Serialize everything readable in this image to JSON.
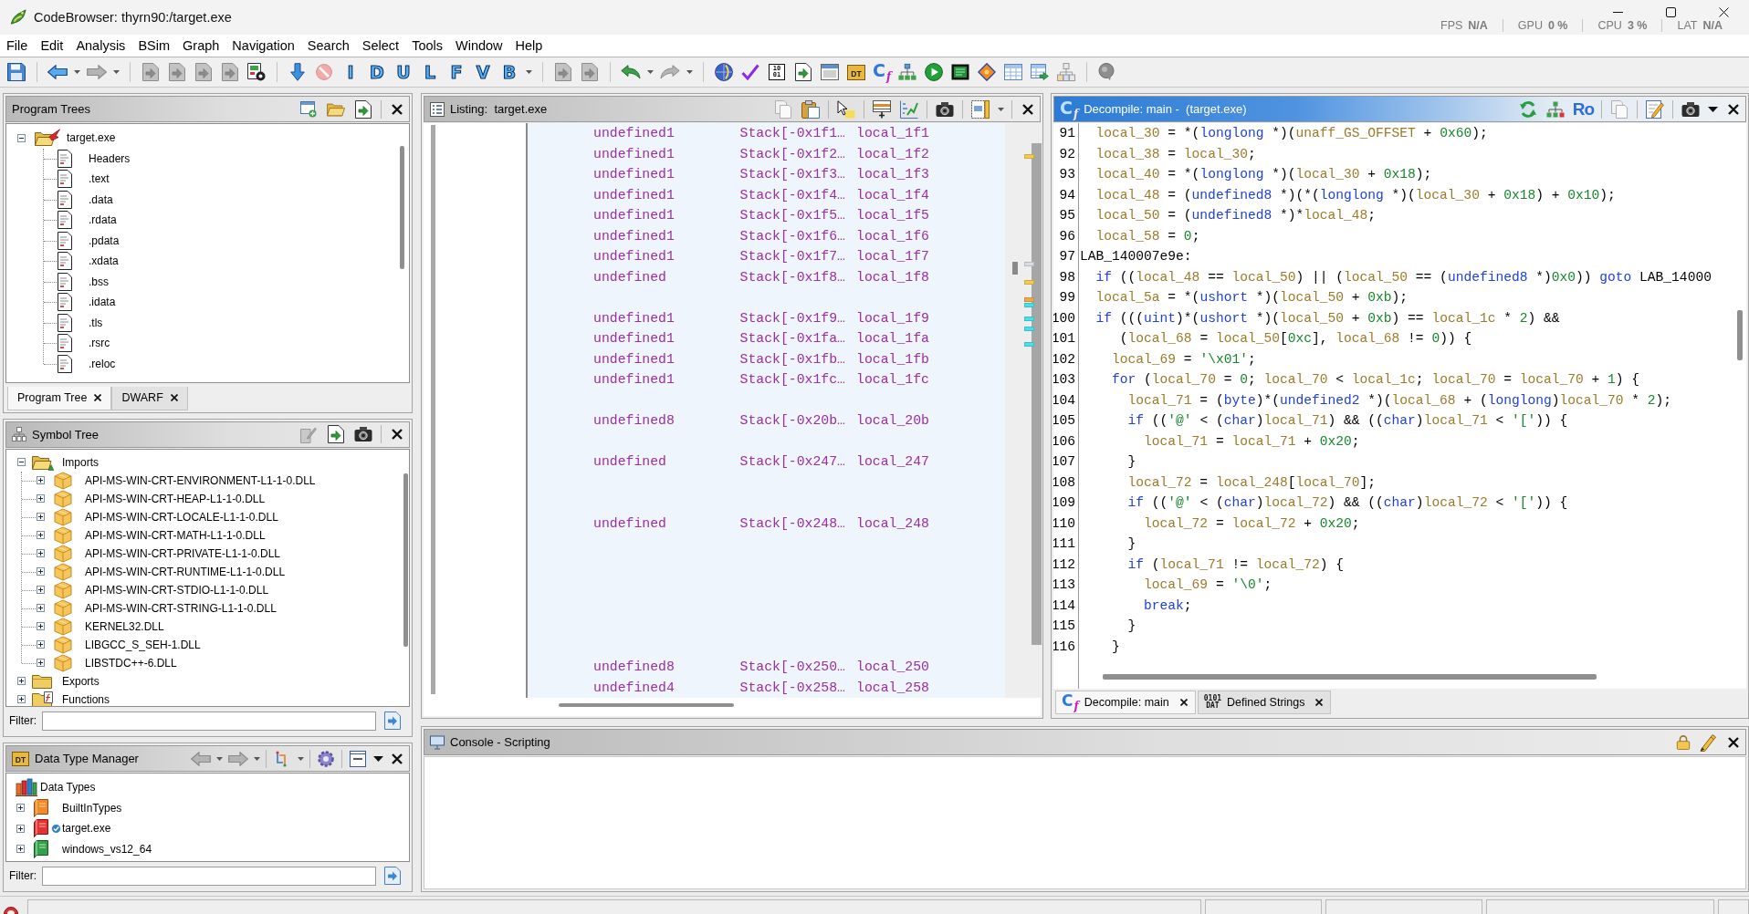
{
  "window": {
    "title": "CodeBrowser: thyrn90:/target.exe"
  },
  "perf_overlay": [
    {
      "label": "FPS",
      "value": "N/A"
    },
    {
      "label": "GPU",
      "value": "0 %"
    },
    {
      "label": "CPU",
      "value": "3 %"
    },
    {
      "label": "LAT",
      "value": "N/A"
    }
  ],
  "menu": [
    "File",
    "Edit",
    "Analysis",
    "BSim",
    "Graph",
    "Navigation",
    "Search",
    "Select",
    "Tools",
    "Window",
    "Help"
  ],
  "toolbar": {
    "letter_tools": [
      "I",
      "D",
      "U",
      "L",
      "F",
      "V",
      "B"
    ],
    "bytes_tool": [
      "10",
      "01"
    ],
    "data_type_tool": "DT",
    "decompiler_tool": [
      "C",
      "f"
    ]
  },
  "program_trees": {
    "title": "Program Trees",
    "active": false,
    "root": {
      "label": "target.exe",
      "expanded": true,
      "children": [
        {
          "label": "Headers"
        },
        {
          "label": ".text"
        },
        {
          "label": ".data"
        },
        {
          "label": ".rdata"
        },
        {
          "label": ".pdata"
        },
        {
          "label": ".xdata"
        },
        {
          "label": ".bss"
        },
        {
          "label": ".idata"
        },
        {
          "label": ".tls"
        },
        {
          "label": ".rsrc"
        },
        {
          "label": ".reloc"
        }
      ]
    },
    "tabs": [
      {
        "label": "Program Tree",
        "selected": true
      },
      {
        "label": "DWARF",
        "selected": false
      }
    ]
  },
  "symbol_tree": {
    "title": "Symbol Tree",
    "active": false,
    "items": [
      {
        "kind": "imports",
        "label": "Imports",
        "expanded": true,
        "children": [
          {
            "label": "API-MS-WIN-CRT-ENVIRONMENT-L1-1-0.DLL",
            "expanded": false
          },
          {
            "label": "API-MS-WIN-CRT-HEAP-L1-1-0.DLL",
            "expanded": false
          },
          {
            "label": "API-MS-WIN-CRT-LOCALE-L1-1-0.DLL",
            "expanded": false
          },
          {
            "label": "API-MS-WIN-CRT-MATH-L1-1-0.DLL",
            "expanded": false
          },
          {
            "label": "API-MS-WIN-CRT-PRIVATE-L1-1-0.DLL",
            "expanded": false
          },
          {
            "label": "API-MS-WIN-CRT-RUNTIME-L1-1-0.DLL",
            "expanded": false
          },
          {
            "label": "API-MS-WIN-CRT-STDIO-L1-1-0.DLL",
            "expanded": false
          },
          {
            "label": "API-MS-WIN-CRT-STRING-L1-1-0.DLL",
            "expanded": false
          },
          {
            "label": "KERNEL32.DLL",
            "expanded": false
          },
          {
            "label": "LIBGCC_S_SEH-1.DLL",
            "expanded": false
          },
          {
            "label": "LIBSTDC++-6.DLL",
            "expanded": false
          }
        ]
      },
      {
        "kind": "exports",
        "label": "Exports",
        "expanded": false
      },
      {
        "kind": "functions",
        "label": "Functions",
        "expanded": false
      }
    ],
    "filter_label": "Filter:"
  },
  "data_type_manager": {
    "title": "Data Type Manager",
    "active": false,
    "icon_text": "DT",
    "root": {
      "label": "Data Types",
      "children": [
        {
          "kind": "builtin",
          "label": "BuiltInTypes",
          "expanded": false
        },
        {
          "kind": "program",
          "label": "target.exe",
          "expanded": false
        },
        {
          "kind": "archive",
          "label": "windows_vs12_64",
          "expanded": false
        }
      ]
    },
    "filter_label": "Filter:"
  },
  "listing": {
    "title": "Listing:  target.exe",
    "active": false,
    "rows": [
      {
        "kind": "variable",
        "type": "undefined1",
        "location": "Stack[-0x1f1…",
        "name": "local_1f1"
      },
      {
        "kind": "variable",
        "type": "undefined1",
        "location": "Stack[-0x1f2…",
        "name": "local_1f2"
      },
      {
        "kind": "variable",
        "type": "undefined1",
        "location": "Stack[-0x1f3…",
        "name": "local_1f3"
      },
      {
        "kind": "variable",
        "type": "undefined1",
        "location": "Stack[-0x1f4…",
        "name": "local_1f4"
      },
      {
        "kind": "variable",
        "type": "undefined1",
        "location": "Stack[-0x1f5…",
        "name": "local_1f5"
      },
      {
        "kind": "variable",
        "type": "undefined1",
        "location": "Stack[-0x1f6…",
        "name": "local_1f6"
      },
      {
        "kind": "variable",
        "type": "undefined1",
        "location": "Stack[-0x1f7…",
        "name": "local_1f7"
      },
      {
        "kind": "variable",
        "type": "undefined",
        "location": "Stack[-0x1f8…",
        "name": "local_1f8"
      },
      {
        "kind": "blank"
      },
      {
        "kind": "variable",
        "type": "undefined1",
        "location": "Stack[-0x1f9…",
        "name": "local_1f9"
      },
      {
        "kind": "variable",
        "type": "undefined1",
        "location": "Stack[-0x1fa…",
        "name": "local_1fa"
      },
      {
        "kind": "variable",
        "type": "undefined1",
        "location": "Stack[-0x1fb…",
        "name": "local_1fb"
      },
      {
        "kind": "variable",
        "type": "undefined1",
        "location": "Stack[-0x1fc…",
        "name": "local_1fc"
      },
      {
        "kind": "blank"
      },
      {
        "kind": "variable",
        "type": "undefined8",
        "location": "Stack[-0x20b…",
        "name": "local_20b"
      },
      {
        "kind": "blank"
      },
      {
        "kind": "variable",
        "type": "undefined",
        "location": "Stack[-0x247…",
        "name": "local_247"
      },
      {
        "kind": "blank"
      },
      {
        "kind": "blank"
      },
      {
        "kind": "variable",
        "type": "undefined",
        "location": "Stack[-0x248…",
        "name": "local_248"
      },
      {
        "kind": "blank"
      },
      {
        "kind": "blank"
      },
      {
        "kind": "blank"
      },
      {
        "kind": "blank"
      },
      {
        "kind": "blank"
      },
      {
        "kind": "blank"
      },
      {
        "kind": "variable",
        "type": "undefined8",
        "location": "Stack[-0x250…",
        "name": "local_250"
      },
      {
        "kind": "variable",
        "type": "undefined4",
        "location": "Stack[-0x258…",
        "name": "local_258"
      }
    ]
  },
  "decompile": {
    "title": "Decompile: main -  (target.exe)",
    "active": true,
    "icon_text": [
      "C",
      "f"
    ],
    "toolbar_text": "Ro",
    "lines": [
      {
        "number": "91",
        "tokens": [
          {
            "kind": "var",
            "text": "  local_30"
          },
          {
            "kind": "plain",
            "text": " = *("
          },
          {
            "kind": "type",
            "text": "longlong"
          },
          {
            "kind": "plain",
            "text": " *)("
          },
          {
            "kind": "var",
            "text": "unaff_GS_OFFSET"
          },
          {
            "kind": "plain",
            "text": " + "
          },
          {
            "kind": "const",
            "text": "0x60"
          },
          {
            "kind": "plain",
            "text": ");"
          }
        ]
      },
      {
        "number": "92",
        "tokens": [
          {
            "kind": "var",
            "text": "  local_38"
          },
          {
            "kind": "plain",
            "text": " = "
          },
          {
            "kind": "var",
            "text": "local_30"
          },
          {
            "kind": "plain",
            "text": ";"
          }
        ]
      },
      {
        "number": "93",
        "tokens": [
          {
            "kind": "var",
            "text": "  local_40"
          },
          {
            "kind": "plain",
            "text": " = *("
          },
          {
            "kind": "type",
            "text": "longlong"
          },
          {
            "kind": "plain",
            "text": " *)("
          },
          {
            "kind": "var",
            "text": "local_30"
          },
          {
            "kind": "plain",
            "text": " + "
          },
          {
            "kind": "const",
            "text": "0x18"
          },
          {
            "kind": "plain",
            "text": ");"
          }
        ]
      },
      {
        "number": "94",
        "tokens": [
          {
            "kind": "var",
            "text": "  local_48"
          },
          {
            "kind": "plain",
            "text": " = ("
          },
          {
            "kind": "type",
            "text": "undefined8"
          },
          {
            "kind": "plain",
            "text": " *)(*("
          },
          {
            "kind": "type",
            "text": "longlong"
          },
          {
            "kind": "plain",
            "text": " *)("
          },
          {
            "kind": "var",
            "text": "local_30"
          },
          {
            "kind": "plain",
            "text": " + "
          },
          {
            "kind": "const",
            "text": "0x18"
          },
          {
            "kind": "plain",
            "text": ") + "
          },
          {
            "kind": "const",
            "text": "0x10"
          },
          {
            "kind": "plain",
            "text": ");"
          }
        ]
      },
      {
        "number": "95",
        "tokens": [
          {
            "kind": "var",
            "text": "  local_50"
          },
          {
            "kind": "plain",
            "text": " = ("
          },
          {
            "kind": "type",
            "text": "undefined8"
          },
          {
            "kind": "plain",
            "text": " *)*"
          },
          {
            "kind": "var",
            "text": "local_48"
          },
          {
            "kind": "plain",
            "text": ";"
          }
        ]
      },
      {
        "number": "96",
        "tokens": [
          {
            "kind": "var",
            "text": "  local_58"
          },
          {
            "kind": "plain",
            "text": " = "
          },
          {
            "kind": "const",
            "text": "0"
          },
          {
            "kind": "plain",
            "text": ";"
          }
        ]
      },
      {
        "number": "97",
        "tokens": [
          {
            "kind": "label",
            "text": "LAB_140007e9e:"
          }
        ]
      },
      {
        "number": "98",
        "tokens": [
          {
            "kind": "keyword",
            "text": "  if"
          },
          {
            "kind": "plain",
            "text": " (("
          },
          {
            "kind": "var",
            "text": "local_48"
          },
          {
            "kind": "plain",
            "text": " == "
          },
          {
            "kind": "var",
            "text": "local_50"
          },
          {
            "kind": "plain",
            "text": ") || ("
          },
          {
            "kind": "var",
            "text": "local_50"
          },
          {
            "kind": "plain",
            "text": " == ("
          },
          {
            "kind": "type",
            "text": "undefined8"
          },
          {
            "kind": "plain",
            "text": " *)"
          },
          {
            "kind": "const",
            "text": "0x0"
          },
          {
            "kind": "plain",
            "text": ")) "
          },
          {
            "kind": "keyword",
            "text": "goto"
          },
          {
            "kind": "label",
            "text": " LAB_14000"
          }
        ]
      },
      {
        "number": "99",
        "tokens": [
          {
            "kind": "var",
            "text": "  local_5a"
          },
          {
            "kind": "plain",
            "text": " = *("
          },
          {
            "kind": "type",
            "text": "ushort"
          },
          {
            "kind": "plain",
            "text": " *)("
          },
          {
            "kind": "var",
            "text": "local_50"
          },
          {
            "kind": "plain",
            "text": " + "
          },
          {
            "kind": "const",
            "text": "0xb"
          },
          {
            "kind": "plain",
            "text": ");"
          }
        ]
      },
      {
        "number": "100",
        "tokens": [
          {
            "kind": "keyword",
            "text": "  if"
          },
          {
            "kind": "plain",
            "text": " ((("
          },
          {
            "kind": "type",
            "text": "uint"
          },
          {
            "kind": "plain",
            "text": ")*("
          },
          {
            "kind": "type",
            "text": "ushort"
          },
          {
            "kind": "plain",
            "text": " *)("
          },
          {
            "kind": "var",
            "text": "local_50"
          },
          {
            "kind": "plain",
            "text": " + "
          },
          {
            "kind": "const",
            "text": "0xb"
          },
          {
            "kind": "plain",
            "text": ") == "
          },
          {
            "kind": "var",
            "text": "local_1c"
          },
          {
            "kind": "plain",
            "text": " * "
          },
          {
            "kind": "const",
            "text": "2"
          },
          {
            "kind": "plain",
            "text": ") &&"
          }
        ]
      },
      {
        "number": "101",
        "tokens": [
          {
            "kind": "plain",
            "text": "     ("
          },
          {
            "kind": "var",
            "text": "local_68"
          },
          {
            "kind": "plain",
            "text": " = "
          },
          {
            "kind": "var",
            "text": "local_50"
          },
          {
            "kind": "plain",
            "text": "["
          },
          {
            "kind": "const",
            "text": "0xc"
          },
          {
            "kind": "plain",
            "text": "], "
          },
          {
            "kind": "var",
            "text": "local_68"
          },
          {
            "kind": "plain",
            "text": " != "
          },
          {
            "kind": "const",
            "text": "0"
          },
          {
            "kind": "plain",
            "text": ")) {"
          }
        ]
      },
      {
        "number": "102",
        "tokens": [
          {
            "kind": "var",
            "text": "    local_69"
          },
          {
            "kind": "plain",
            "text": " = "
          },
          {
            "kind": "const",
            "text": "'\\x01'"
          },
          {
            "kind": "plain",
            "text": ";"
          }
        ]
      },
      {
        "number": "103",
        "tokens": [
          {
            "kind": "keyword",
            "text": "    for"
          },
          {
            "kind": "plain",
            "text": " ("
          },
          {
            "kind": "var",
            "text": "local_70"
          },
          {
            "kind": "plain",
            "text": " = "
          },
          {
            "kind": "const",
            "text": "0"
          },
          {
            "kind": "plain",
            "text": "; "
          },
          {
            "kind": "var",
            "text": "local_70"
          },
          {
            "kind": "plain",
            "text": " < "
          },
          {
            "kind": "var",
            "text": "local_1c"
          },
          {
            "kind": "plain",
            "text": "; "
          },
          {
            "kind": "var",
            "text": "local_70"
          },
          {
            "kind": "plain",
            "text": " = "
          },
          {
            "kind": "var",
            "text": "local_70"
          },
          {
            "kind": "plain",
            "text": " + "
          },
          {
            "kind": "const",
            "text": "1"
          },
          {
            "kind": "plain",
            "text": ") {"
          }
        ]
      },
      {
        "number": "104",
        "tokens": [
          {
            "kind": "var",
            "text": "      local_71"
          },
          {
            "kind": "plain",
            "text": " = ("
          },
          {
            "kind": "type",
            "text": "byte"
          },
          {
            "kind": "plain",
            "text": ")*("
          },
          {
            "kind": "type",
            "text": "undefined2"
          },
          {
            "kind": "plain",
            "text": " *)("
          },
          {
            "kind": "var",
            "text": "local_68"
          },
          {
            "kind": "plain",
            "text": " + ("
          },
          {
            "kind": "type",
            "text": "longlong"
          },
          {
            "kind": "plain",
            "text": ")"
          },
          {
            "kind": "var",
            "text": "local_70"
          },
          {
            "kind": "plain",
            "text": " * "
          },
          {
            "kind": "const",
            "text": "2"
          },
          {
            "kind": "plain",
            "text": ");"
          }
        ]
      },
      {
        "number": "105",
        "tokens": [
          {
            "kind": "keyword",
            "text": "      if"
          },
          {
            "kind": "plain",
            "text": " (("
          },
          {
            "kind": "const",
            "text": "'@'"
          },
          {
            "kind": "plain",
            "text": " < ("
          },
          {
            "kind": "type",
            "text": "char"
          },
          {
            "kind": "plain",
            "text": ")"
          },
          {
            "kind": "var",
            "text": "local_71"
          },
          {
            "kind": "plain",
            "text": ") && (("
          },
          {
            "kind": "type",
            "text": "char"
          },
          {
            "kind": "plain",
            "text": ")"
          },
          {
            "kind": "var",
            "text": "local_71"
          },
          {
            "kind": "plain",
            "text": " < "
          },
          {
            "kind": "const",
            "text": "'['"
          },
          {
            "kind": "plain",
            "text": ")) {"
          }
        ]
      },
      {
        "number": "106",
        "tokens": [
          {
            "kind": "var",
            "text": "        local_71"
          },
          {
            "kind": "plain",
            "text": " = "
          },
          {
            "kind": "var",
            "text": "local_71"
          },
          {
            "kind": "plain",
            "text": " + "
          },
          {
            "kind": "const",
            "text": "0x20"
          },
          {
            "kind": "plain",
            "text": ";"
          }
        ]
      },
      {
        "number": "107",
        "tokens": [
          {
            "kind": "plain",
            "text": "      }"
          }
        ]
      },
      {
        "number": "108",
        "tokens": [
          {
            "kind": "var",
            "text": "      local_72"
          },
          {
            "kind": "plain",
            "text": " = "
          },
          {
            "kind": "var",
            "text": "local_248"
          },
          {
            "kind": "plain",
            "text": "["
          },
          {
            "kind": "var",
            "text": "local_70"
          },
          {
            "kind": "plain",
            "text": "];"
          }
        ]
      },
      {
        "number": "109",
        "tokens": [
          {
            "kind": "keyword",
            "text": "      if"
          },
          {
            "kind": "plain",
            "text": " (("
          },
          {
            "kind": "const",
            "text": "'@'"
          },
          {
            "kind": "plain",
            "text": " < ("
          },
          {
            "kind": "type",
            "text": "char"
          },
          {
            "kind": "plain",
            "text": ")"
          },
          {
            "kind": "var",
            "text": "local_72"
          },
          {
            "kind": "plain",
            "text": ") && (("
          },
          {
            "kind": "type",
            "text": "char"
          },
          {
            "kind": "plain",
            "text": ")"
          },
          {
            "kind": "var",
            "text": "local_72"
          },
          {
            "kind": "plain",
            "text": " < "
          },
          {
            "kind": "const",
            "text": "'['"
          },
          {
            "kind": "plain",
            "text": ")) {"
          }
        ]
      },
      {
        "number": "110",
        "tokens": [
          {
            "kind": "var",
            "text": "        local_72"
          },
          {
            "kind": "plain",
            "text": " = "
          },
          {
            "kind": "var",
            "text": "local_72"
          },
          {
            "kind": "plain",
            "text": " + "
          },
          {
            "kind": "const",
            "text": "0x20"
          },
          {
            "kind": "plain",
            "text": ";"
          }
        ]
      },
      {
        "number": "111",
        "tokens": [
          {
            "kind": "plain",
            "text": "      }"
          }
        ]
      },
      {
        "number": "112",
        "tokens": [
          {
            "kind": "keyword",
            "text": "      if"
          },
          {
            "kind": "plain",
            "text": " ("
          },
          {
            "kind": "var",
            "text": "local_71"
          },
          {
            "kind": "plain",
            "text": " != "
          },
          {
            "kind": "var",
            "text": "local_72"
          },
          {
            "kind": "plain",
            "text": ") {"
          }
        ]
      },
      {
        "number": "113",
        "tokens": [
          {
            "kind": "var",
            "text": "        local_69"
          },
          {
            "kind": "plain",
            "text": " = "
          },
          {
            "kind": "const",
            "text": "'\\0'"
          },
          {
            "kind": "plain",
            "text": ";"
          }
        ]
      },
      {
        "number": "114",
        "tokens": [
          {
            "kind": "keyword",
            "text": "        break"
          },
          {
            "kind": "plain",
            "text": ";"
          }
        ]
      },
      {
        "number": "115",
        "tokens": [
          {
            "kind": "plain",
            "text": "      }"
          }
        ]
      },
      {
        "number": "116",
        "tokens": [
          {
            "kind": "plain",
            "text": "    }"
          }
        ]
      }
    ],
    "tabs": [
      {
        "kind": "decompile",
        "icon_text": [
          "C",
          "f"
        ],
        "label": "Decompile: main",
        "selected": true
      },
      {
        "kind": "strings",
        "icon_text": [
          "0101",
          "DAT"
        ],
        "label": "Defined Strings",
        "selected": false
      }
    ]
  },
  "console": {
    "title": "Console - Scripting",
    "active": false
  }
}
